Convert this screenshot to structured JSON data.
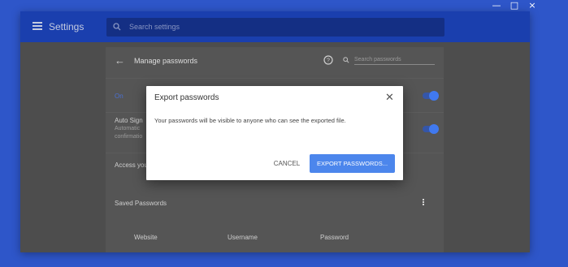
{
  "window_controls": {
    "minimize": "—",
    "maximize": "□",
    "close": "×"
  },
  "header": {
    "title": "Settings",
    "search_placeholder": "Search settings"
  },
  "manage": {
    "title": "Manage passwords",
    "search_placeholder": "Search passwords",
    "offer_label": "On",
    "auto_sign_title": "Auto Sign",
    "auto_sign_sub1": "Automatic",
    "auto_sign_sub2": "confirmatio",
    "access_label": "Access you",
    "saved_title": "Saved Passwords",
    "columns": [
      "Website",
      "Username",
      "Password"
    ]
  },
  "dialog": {
    "title": "Export passwords",
    "message": "Your passwords will be visible to anyone who can see the exported file.",
    "cancel_label": "CANCEL",
    "export_label": "EXPORT PASSWORDS...",
    "close": "✕"
  }
}
